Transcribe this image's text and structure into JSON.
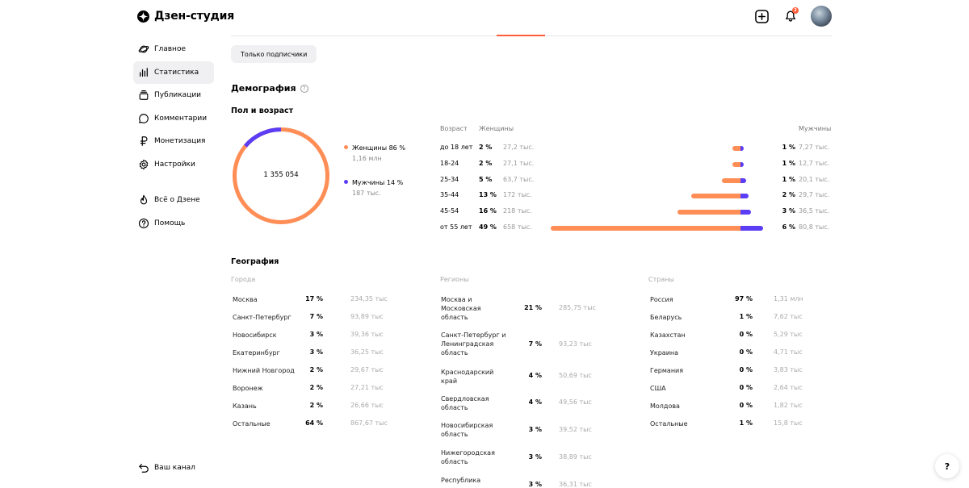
{
  "app": {
    "title": "Дзен-студия"
  },
  "header": {
    "notif_count": "2"
  },
  "sidebar": {
    "items": [
      {
        "label": "Главное"
      },
      {
        "label": "Статистика"
      },
      {
        "label": "Публикации"
      },
      {
        "label": "Комментарии"
      },
      {
        "label": "Монетизация"
      },
      {
        "label": "Настройки"
      },
      {
        "label": "Всё о Дзене"
      },
      {
        "label": "Помощь"
      }
    ],
    "bottom_label": "Ваш канал"
  },
  "filter": {
    "chip_label": "Только подписчики"
  },
  "demography": {
    "title": "Демография",
    "gender_age_title": "Пол и возраст",
    "total": "1 355 054",
    "women_share": 0.86,
    "legend": {
      "women_label": "Женщины 86 %",
      "women_count": "1,16 млн",
      "men_label": "Мужчины 14 %",
      "men_count": "187 тыс."
    },
    "colors": {
      "women": "#ff8d56",
      "men": "#5b3df5",
      "accent": "#ff5c38"
    },
    "age_headers": {
      "age": "Возраст",
      "women": "Женщины",
      "men": "Мужчины"
    },
    "age_rows": [
      {
        "age": "до 18 лет",
        "w_pct": "2 %",
        "w_cnt": "27,2 тыс.",
        "m_pct": "1 %",
        "m_cnt": "7,27 тыс.",
        "w_val": 27.2,
        "m_val": 7.27
      },
      {
        "age": "18-24",
        "w_pct": "2 %",
        "w_cnt": "27,1 тыс.",
        "m_pct": "1 %",
        "m_cnt": "12,7 тыс.",
        "w_val": 27.1,
        "m_val": 12.7
      },
      {
        "age": "25-34",
        "w_pct": "5 %",
        "w_cnt": "63,7 тыс.",
        "m_pct": "1 %",
        "m_cnt": "20,1 тыс.",
        "w_val": 63.7,
        "m_val": 20.1
      },
      {
        "age": "35-44",
        "w_pct": "13 %",
        "w_cnt": "172 тыс.",
        "m_pct": "2 %",
        "m_cnt": "29,7 тыс.",
        "w_val": 172,
        "m_val": 29.7
      },
      {
        "age": "45-54",
        "w_pct": "16 %",
        "w_cnt": "218 тыс.",
        "m_pct": "3 %",
        "m_cnt": "36,5 тыс.",
        "w_val": 218,
        "m_val": 36.5
      },
      {
        "age": "от 55 лет",
        "w_pct": "49 %",
        "w_cnt": "658 тыс.",
        "m_pct": "6 %",
        "m_cnt": "80,8 тыс.",
        "w_val": 658,
        "m_val": 80.8
      }
    ]
  },
  "geography": {
    "title": "География",
    "cities": {
      "header": "Города",
      "rows": [
        {
          "name": "Москва",
          "pct": "17 %",
          "cnt": "234,35 тыс"
        },
        {
          "name": "Санкт-Петербург",
          "pct": "7 %",
          "cnt": "93,89 тыс"
        },
        {
          "name": "Новосибирск",
          "pct": "3 %",
          "cnt": "39,36 тыс"
        },
        {
          "name": "Екатеринбург",
          "pct": "3 %",
          "cnt": "36,25 тыс"
        },
        {
          "name": "Нижний Новгород",
          "pct": "2 %",
          "cnt": "29,67 тыс"
        },
        {
          "name": "Воронеж",
          "pct": "2 %",
          "cnt": "27,21 тыс"
        },
        {
          "name": "Казань",
          "pct": "2 %",
          "cnt": "26,66 тыс"
        },
        {
          "name": "Остальные",
          "pct": "64 %",
          "cnt": "867,67 тыс"
        }
      ]
    },
    "regions": {
      "header": "Регионы",
      "rows": [
        {
          "name": "Москва и Московская область",
          "pct": "21 %",
          "cnt": "285,75 тыс"
        },
        {
          "name": "Санкт-Петербург и Ленинградская область",
          "pct": "7 %",
          "cnt": "93,23 тыс"
        },
        {
          "name": "Краснодарский край",
          "pct": "4 %",
          "cnt": "50,69 тыс"
        },
        {
          "name": "Свердловская область",
          "pct": "4 %",
          "cnt": "49,56 тыс"
        },
        {
          "name": "Новосибирская область",
          "pct": "3 %",
          "cnt": "39,52 тыс"
        },
        {
          "name": "Нижегородская область",
          "pct": "3 %",
          "cnt": "38,89 тыс"
        },
        {
          "name": "Республика",
          "pct": "3 %",
          "cnt": "36,31 тыс"
        }
      ]
    },
    "countries": {
      "header": "Страны",
      "rows": [
        {
          "name": "Россия",
          "pct": "97 %",
          "cnt": "1,31 млн"
        },
        {
          "name": "Беларусь",
          "pct": "1 %",
          "cnt": "7,62 тыс"
        },
        {
          "name": "Казахстан",
          "pct": "0 %",
          "cnt": "5,29 тыс"
        },
        {
          "name": "Украина",
          "pct": "0 %",
          "cnt": "4,71 тыс"
        },
        {
          "name": "Германия",
          "pct": "0 %",
          "cnt": "3,83 тыс"
        },
        {
          "name": "США",
          "pct": "0 %",
          "cnt": "2,64 тыс"
        },
        {
          "name": "Молдова",
          "pct": "0 %",
          "cnt": "1,82 тыс"
        },
        {
          "name": "Остальные",
          "pct": "1 %",
          "cnt": "15,8 тыс"
        }
      ]
    }
  },
  "help_fab": {
    "label": "?"
  }
}
